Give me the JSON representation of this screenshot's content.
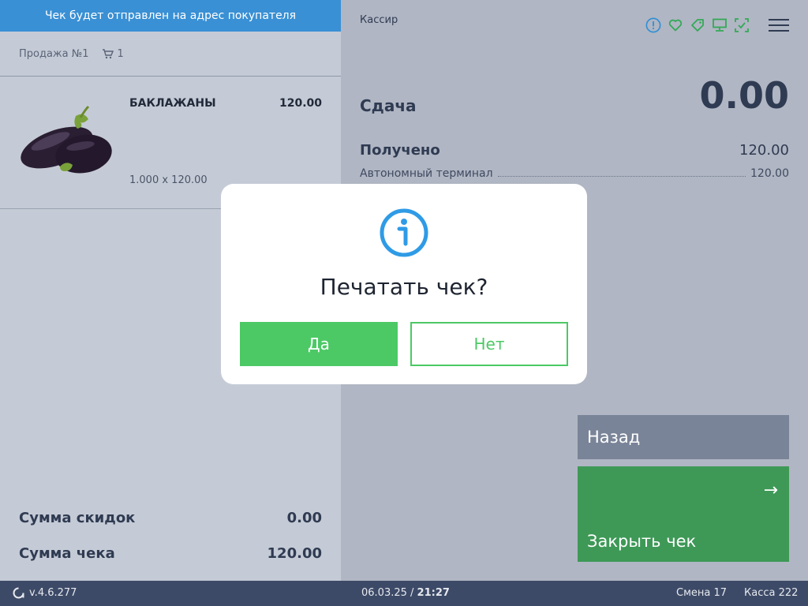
{
  "left": {
    "banner": "Чек будет отправлен на адрес покупателя",
    "sale_title": "Продажа №1",
    "cart_count": "1",
    "item": {
      "name": "БАКЛАЖАНЫ",
      "price": "120.00",
      "qty_line": "1.000 x 120.00",
      "image_icon": "eggplant-image"
    },
    "discount_label": "Сумма скидок",
    "discount_value": "0.00",
    "total_label": "Сумма чека",
    "total_value": "120.00"
  },
  "right": {
    "cashier": "Кассир",
    "status_icons": [
      "alert-circle-icon",
      "heart-icon",
      "tag-icon",
      "monitor-icon",
      "scan-check-icon"
    ],
    "change_label": "Сдача",
    "change_value": "0.00",
    "received_label": "Получено",
    "received_value": "120.00",
    "terminal_label": "Автономный терминал",
    "terminal_value": "120.00",
    "back_label": "Назад",
    "close_label": "Закрыть чек",
    "close_arrow": "→"
  },
  "footer": {
    "version": "v.4.6.277",
    "date": "06.03.25",
    "separator": " / ",
    "time": "21:27",
    "shift": "Смена 17",
    "kassa": "Касса 222"
  },
  "dialog": {
    "question": "Печатать чек?",
    "yes_label": "Да",
    "no_label": "Нет"
  },
  "colors": {
    "accent_blue": "#3a90d4",
    "accent_green": "#4cc965",
    "close_green": "#3e9957",
    "footer_bg": "#3d4a67"
  }
}
